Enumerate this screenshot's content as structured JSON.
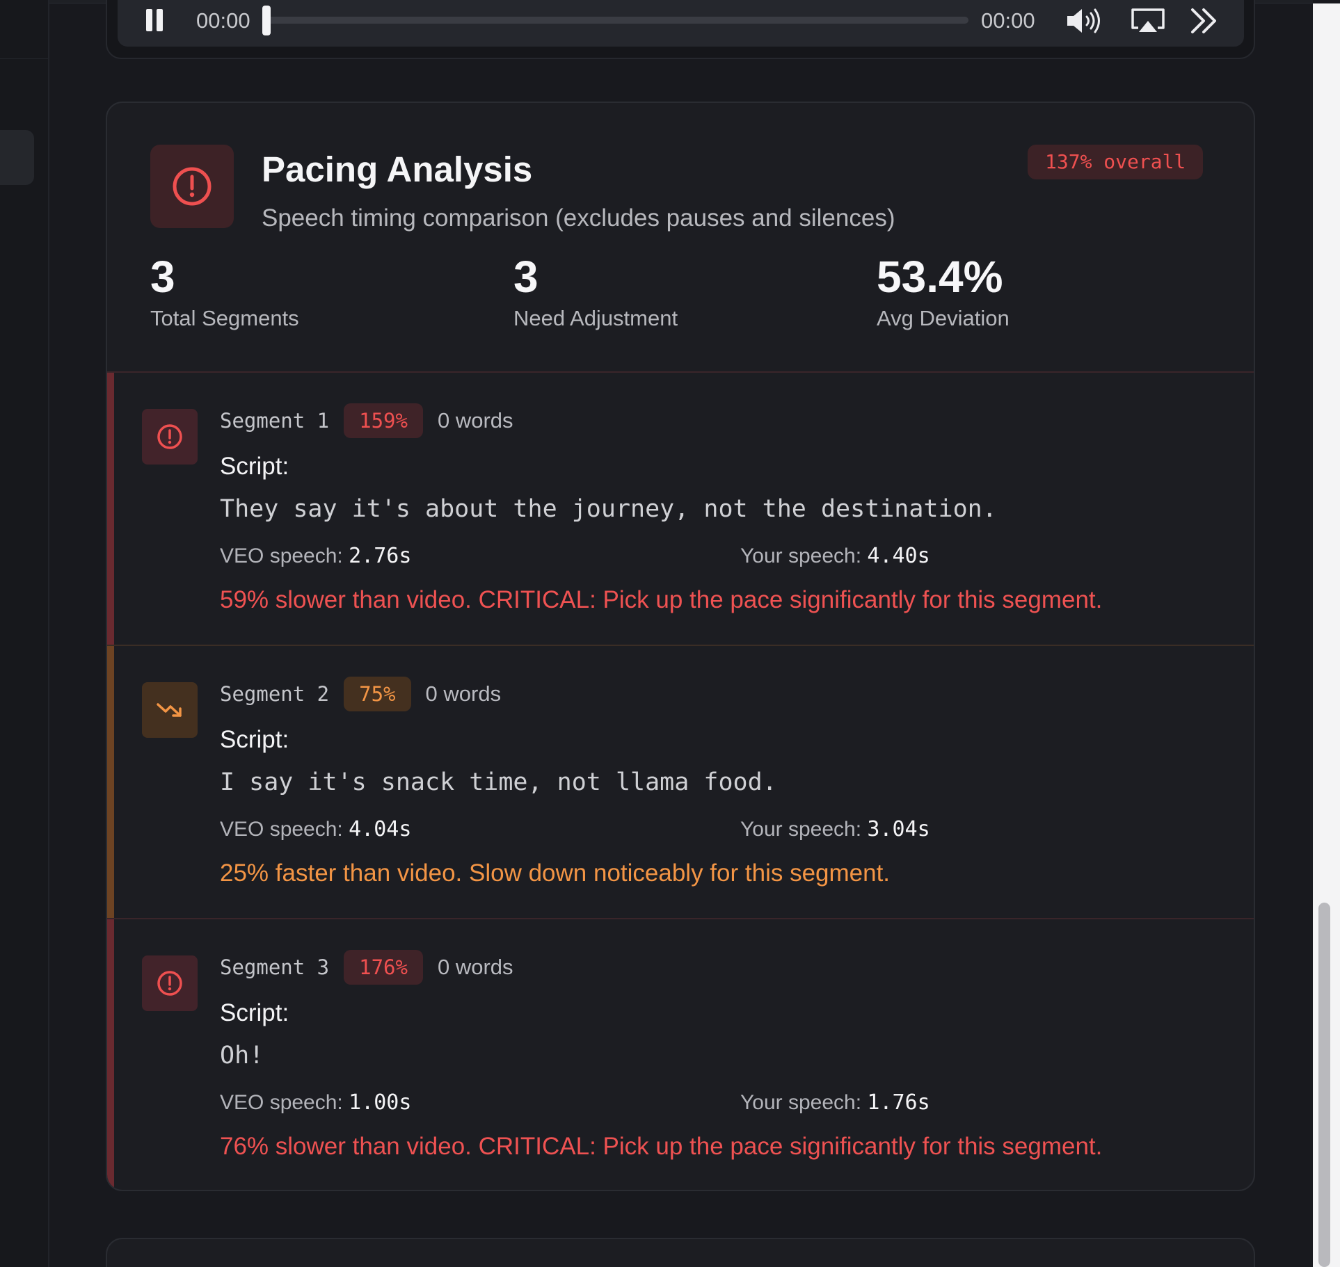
{
  "player": {
    "current_time": "00:00",
    "total_time": "00:00",
    "progress": 0.0
  },
  "pacing": {
    "title": "Pacing Analysis",
    "subtitle": "Speech timing comparison (excludes pauses and silences)",
    "overall_badge": "137% overall",
    "stats": [
      {
        "value": "3",
        "label": "Total Segments"
      },
      {
        "value": "3",
        "label": "Need Adjustment"
      },
      {
        "value": "53.4%",
        "label": "Avg Deviation"
      }
    ],
    "script_label": "Script:",
    "veo_label": "VEO speech:",
    "your_label": "Your speech:",
    "segments": [
      {
        "name": "Segment 1",
        "badge": "159%",
        "words": "0 words",
        "severity": "critical",
        "script": "They say it's about the journey, not the destination.",
        "veo_speech": "2.76s",
        "your_speech": "4.40s",
        "advice": "59% slower than video. CRITICAL: Pick up the pace significantly for this segment."
      },
      {
        "name": "Segment 2",
        "badge": "75%",
        "words": "0 words",
        "severity": "warning",
        "script": "I say it's snack time, not llama food.",
        "veo_speech": "4.04s",
        "your_speech": "3.04s",
        "advice": "25% faster than video. Slow down noticeably for this segment."
      },
      {
        "name": "Segment 3",
        "badge": "176%",
        "words": "0 words",
        "severity": "critical",
        "script": "Oh!",
        "veo_speech": "1.00s",
        "your_speech": "1.76s",
        "advice": "76% slower than video. CRITICAL: Pick up the pace significantly for this segment."
      }
    ]
  },
  "colors": {
    "critical": "#ef5050",
    "warning": "#f39545",
    "background": "#18191e",
    "card": "#1c1d22"
  },
  "icons": {
    "player": [
      "pause-icon",
      "volume-icon",
      "airplay-icon",
      "skip-forward-icon"
    ],
    "critical": "alert-circle-icon",
    "warning": "trending-down-icon"
  }
}
